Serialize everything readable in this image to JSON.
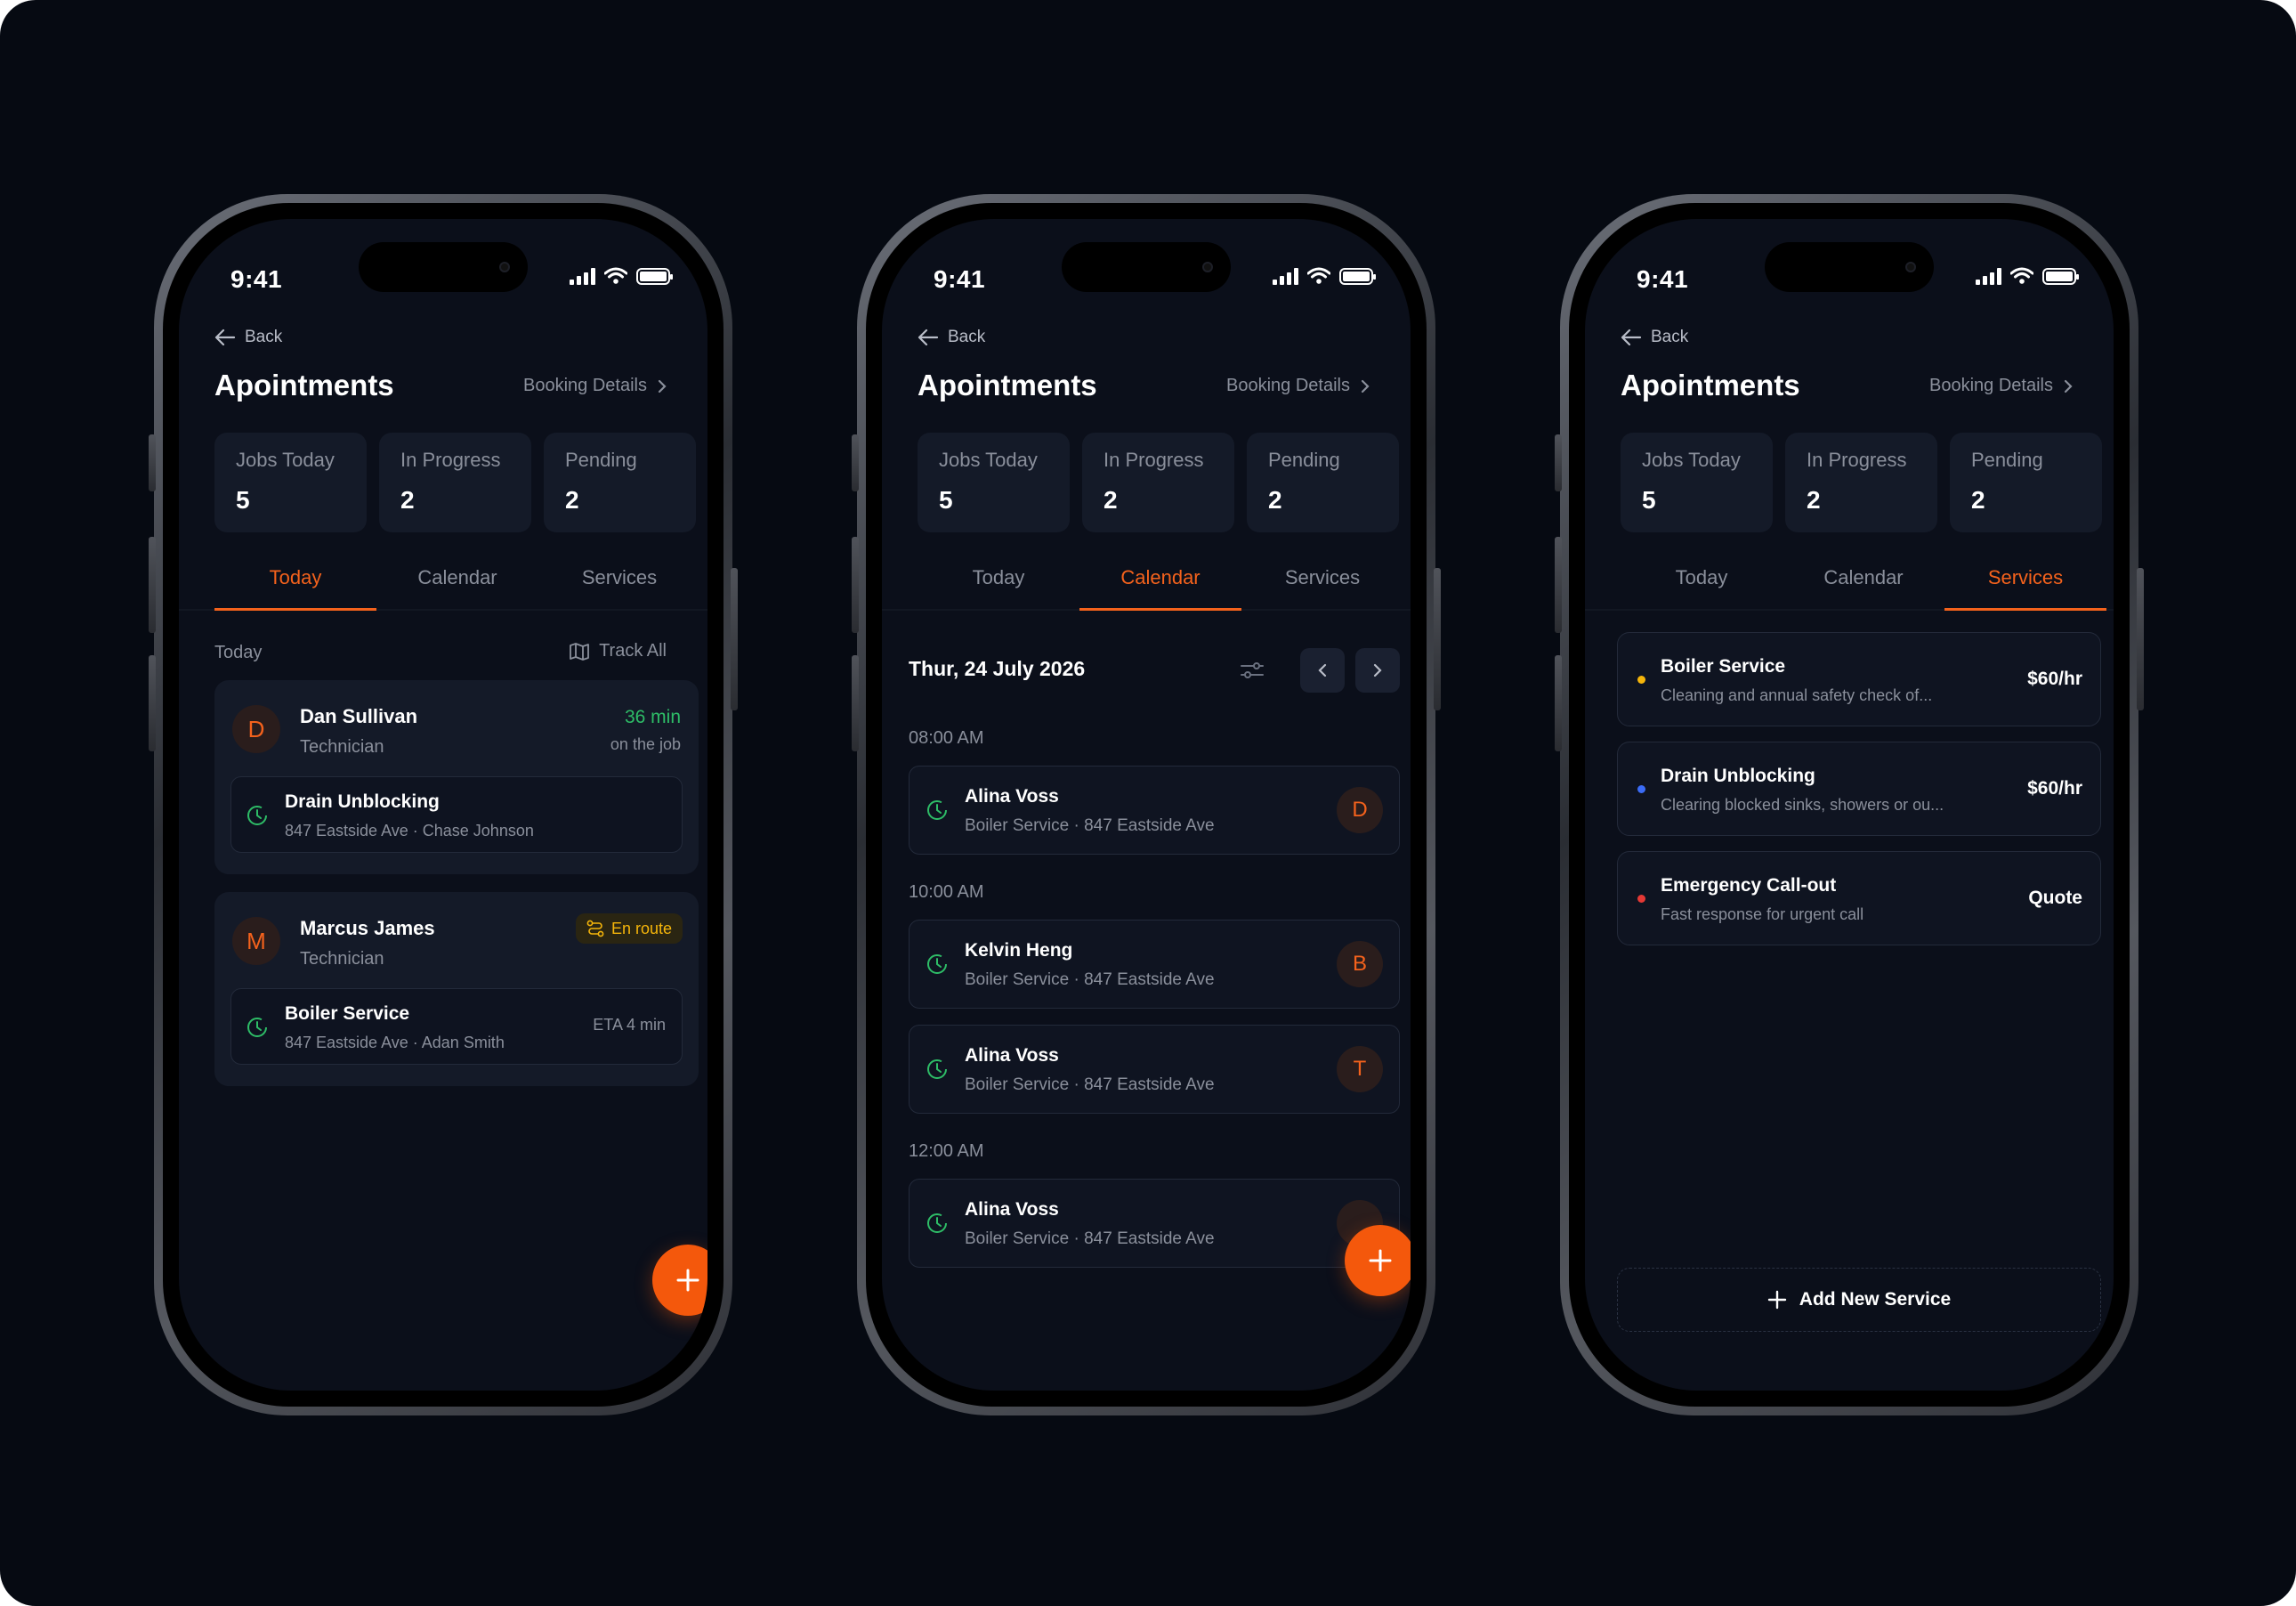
{
  "accent": "#f4621c",
  "status": {
    "time": "9:41"
  },
  "common": {
    "back_label": "Back",
    "title": "Apointments",
    "booking_label": "Booking Details",
    "stats": [
      {
        "label": "Jobs Today",
        "value": "5"
      },
      {
        "label": "In Progress",
        "value": "2"
      },
      {
        "label": "Pending",
        "value": "2"
      }
    ],
    "tabs": [
      "Today",
      "Calendar",
      "Services"
    ]
  },
  "today": {
    "section_label": "Today",
    "track_all": "Track All",
    "cards": [
      {
        "initial": "D",
        "name": "Dan Sullivan",
        "role": "Technician",
        "status_value": "36 min",
        "status_sub": "on the job",
        "job": {
          "title": "Drain Unblocking",
          "detail": "847 Eastside Ave · Chase Johnson"
        }
      },
      {
        "initial": "M",
        "name": "Marcus James",
        "role": "Technician",
        "badge": "En route",
        "job": {
          "title": "Boiler Service",
          "detail": "847 Eastside Ave · Adan Smith",
          "eta": "ETA 4 min"
        }
      }
    ]
  },
  "calendar": {
    "date": "Thur, 24 July 2026",
    "slots": [
      {
        "time": "08:00 AM",
        "items": [
          {
            "name": "Alina Voss",
            "detail": "Boiler Service · 847 Eastside Ave",
            "initial": "D"
          }
        ]
      },
      {
        "time": "10:00 AM",
        "items": [
          {
            "name": "Kelvin Heng",
            "detail": "Boiler Service · 847 Eastside Ave",
            "initial": "B"
          },
          {
            "name": "Alina Voss",
            "detail": "Boiler Service · 847 Eastside Ave",
            "initial": "T"
          }
        ]
      },
      {
        "time": "12:00 AM",
        "items": [
          {
            "name": "Alina Voss",
            "detail": "Boiler Service · 847 Eastside Ave",
            "initial": ""
          }
        ]
      }
    ]
  },
  "services": {
    "items": [
      {
        "name": "Boiler Service",
        "desc": "Cleaning and annual safety check of...",
        "price": "$60/hr",
        "color": "#f5b50a"
      },
      {
        "name": "Drain Unblocking",
        "desc": "Clearing blocked sinks, showers or ou...",
        "price": "$60/hr",
        "color": "#3b6cf6"
      },
      {
        "name": "Emergency Call-out",
        "desc": "Fast response for urgent call",
        "price": "Quote",
        "color": "#e53935"
      }
    ],
    "add_label": "Add New Service"
  }
}
